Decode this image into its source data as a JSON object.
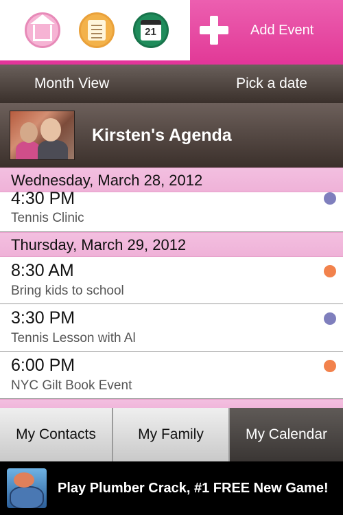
{
  "topbar": {
    "icons": [
      "home-icon",
      "notes-icon",
      "calendar-icon"
    ],
    "calendar_icon_day": "21",
    "add_label": "Add Event"
  },
  "viewbar": {
    "month_view": "Month View",
    "pick_date": "Pick a date"
  },
  "agenda": {
    "title": "Kirsten's Agenda"
  },
  "days": [
    {
      "date": "Wednesday, March 28, 2012",
      "events": [
        {
          "time": "4:30 PM",
          "title": "Tennis Clinic",
          "color": "#7f7fbd"
        }
      ]
    },
    {
      "date": "Thursday, March 29, 2012",
      "events": [
        {
          "time": "8:30 AM",
          "title": "Bring kids to school",
          "color": "#f2824c"
        },
        {
          "time": "3:30 PM",
          "title": "Tennis Lesson with Al",
          "color": "#7f7fbd"
        },
        {
          "time": "6:00 PM",
          "title": "NYC Gilt Book Event",
          "color": "#f2824c"
        }
      ]
    }
  ],
  "tabs": {
    "contacts": "My Contacts",
    "family": "My Family",
    "calendar": "My Calendar",
    "active": "calendar"
  },
  "ad": {
    "text": "Play Plumber Crack, #1 FREE New Game!"
  },
  "colors": {
    "accent_pink": "#e3359a",
    "header_brown": "#4a3f3a",
    "day_header_pink": "#f1b8dc",
    "dot_purple": "#7f7fbd",
    "dot_orange": "#f2824c"
  }
}
